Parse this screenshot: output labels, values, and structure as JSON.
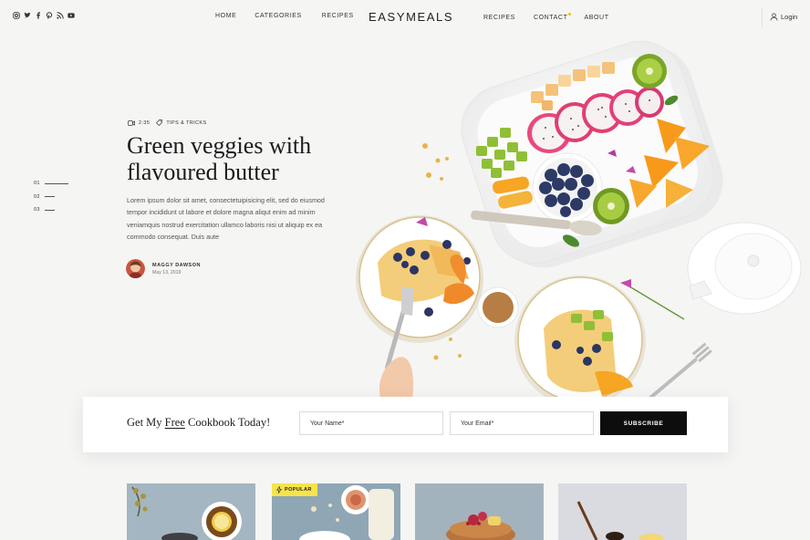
{
  "header": {
    "logo": "EASYMEALS",
    "nav_left": [
      "HOME",
      "CATEGORIES",
      "RECIPES"
    ],
    "nav_right": [
      "RECIPES",
      "CONTACT",
      "ABOUT"
    ],
    "login_label": "Login",
    "socials": [
      "instagram-icon",
      "twitter-icon",
      "facebook-icon",
      "pinterest-icon",
      "rss-icon",
      "youtube-icon"
    ]
  },
  "slider": {
    "items": [
      "01",
      "02",
      "03"
    ],
    "active_index": 0
  },
  "hero": {
    "video_duration": "2:35",
    "category": "TIPS & TRICKS",
    "title_line1": "Green veggies with",
    "title_line2": "flavoured butter",
    "body": "Lorem ipsum dolor sit amet, consectetuipisicing elit, sed do eiusmod tempor incididunt ut labore et dolore magna aliqut enim ad minim veniamquis nostrud exercitation ullamco laboris nisi ut aliquip ex ea commodo consequat. Duis aute",
    "author_name": "MAGGY DAWSON",
    "author_date": "May 13, 2019"
  },
  "subscribe": {
    "title_before": "Get My ",
    "title_emphasis": "Free",
    "title_after": " Cookbook Today!",
    "name_placeholder": "Your Name*",
    "email_placeholder": "Your Email*",
    "button_label": "SUBSCRIBE"
  },
  "cards": [
    {
      "badge": ""
    },
    {
      "badge": "POPULAR"
    },
    {
      "badge": ""
    },
    {
      "badge": ""
    }
  ],
  "colors": {
    "background": "#f5f5f4",
    "accent_yellow": "#f7e34b",
    "button_black": "#0d0d0d"
  }
}
